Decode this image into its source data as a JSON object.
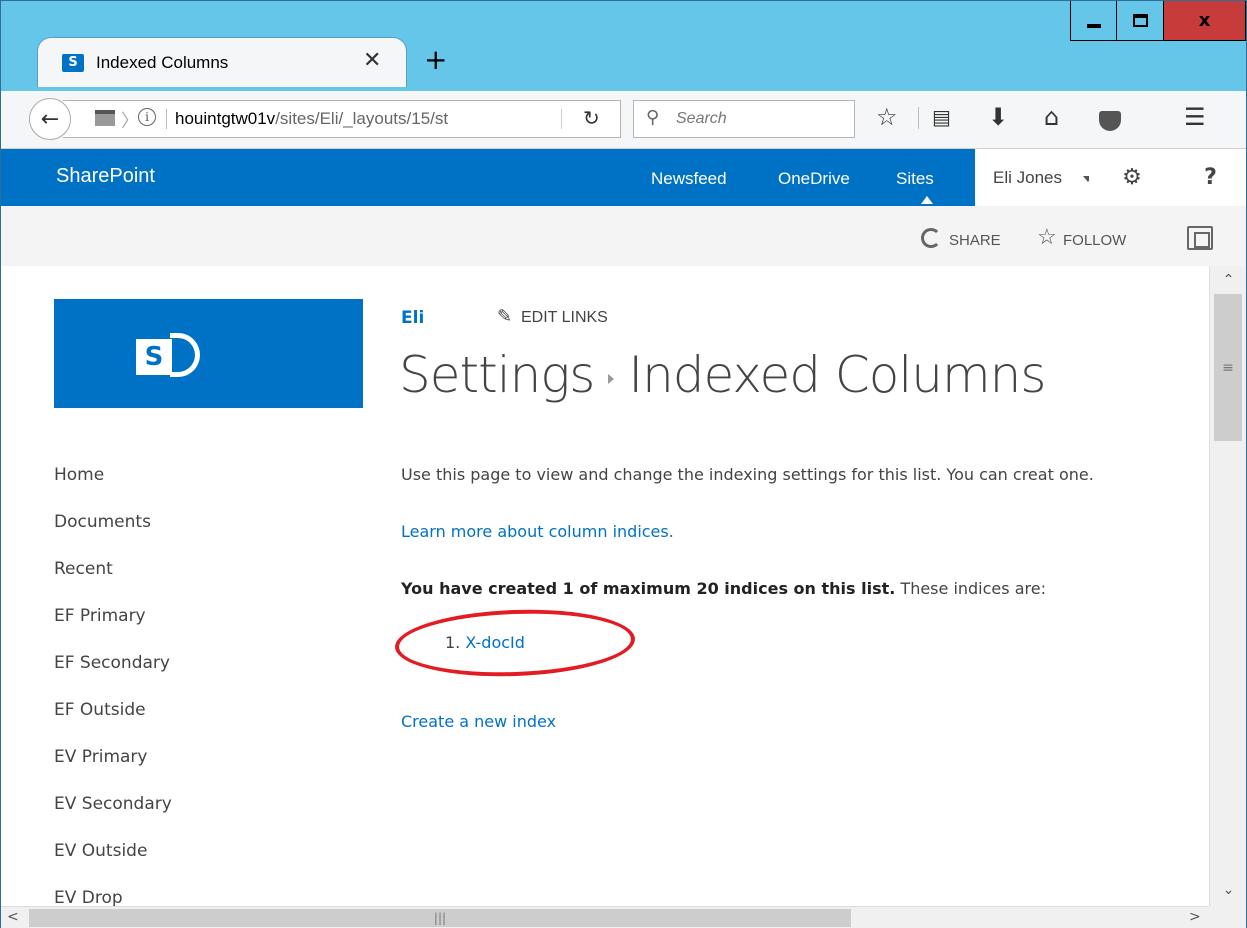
{
  "window": {
    "close_label": "x"
  },
  "tab": {
    "favicon": "S",
    "title": "Indexed Columns",
    "close": "✕",
    "new_tab": "+"
  },
  "navbar": {
    "back": "←",
    "url_host": "houintgtw01v",
    "url_path": "/sites/Eli/_layouts/15/st",
    "info": "i",
    "reload": "↻",
    "search_placeholder": "Search",
    "search_icon": "⚲"
  },
  "suitebar": {
    "brand": "SharePoint",
    "links": {
      "newsfeed": "Newsfeed",
      "onedrive": "OneDrive",
      "sites": "Sites"
    },
    "user": "Eli Jones",
    "gear": "⚙",
    "help": "?"
  },
  "actionbar": {
    "share": "SHARE",
    "follow": "FOLLOW",
    "follow_icon": "☆"
  },
  "logo": {
    "letter": "S"
  },
  "breadcrumb": {
    "site": "Eli",
    "edit_links": "EDIT LINKS",
    "edit_icon": "✎"
  },
  "title": {
    "parent": "Settings",
    "current": "Indexed Columns"
  },
  "quick_launch": [
    "Home",
    "Documents",
    "Recent",
    "EF Primary",
    "EF Secondary",
    "EF Outside",
    "EV Primary",
    "EV Secondary",
    "EV Outside",
    "EV Drop"
  ],
  "main": {
    "description": "Use this page to view and change the indexing settings for this list. You can creat one.",
    "learn_more": "Learn more about column indices.",
    "summary_bold": "You have created 1 of maximum 20 indices on this list.",
    "summary_rest": " These indices are:",
    "index_number": "1.",
    "index_name": "X-docId",
    "create_link": "Create a new index"
  },
  "icons": {
    "bookmark": "star-icon",
    "reading_list": "reading-list-icon",
    "download": "download-icon",
    "home": "home-icon",
    "pocket": "pocket-icon",
    "menu": "hamburger-menu-icon"
  },
  "colors": {
    "suite_bar": "#0072c6",
    "link": "#0072c6",
    "titlebar": "#66c6ea",
    "close_button": "#c83b3b",
    "highlight": "#e31b23"
  }
}
